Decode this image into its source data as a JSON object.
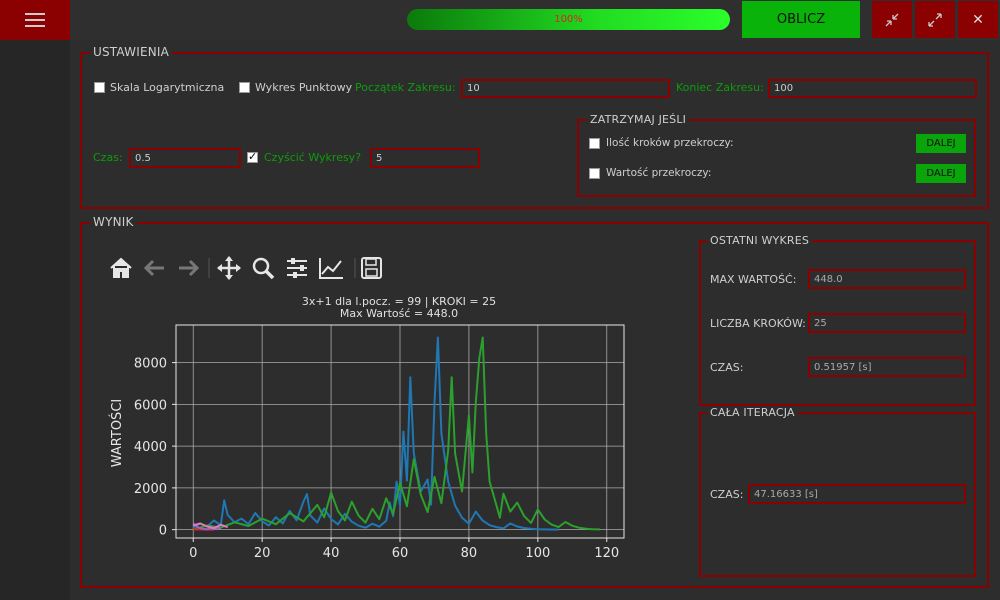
{
  "header": {
    "progress_value": 1.0,
    "progress_text": "100%",
    "calc_label": "OBLICZ",
    "menu_icon": "hamburger-icon",
    "win_icons": [
      "minimize-icon",
      "maximize-icon",
      "close-icon"
    ]
  },
  "settings": {
    "title": "USTAWIENIA",
    "log_scale_label": "Skala Logarytmiczna",
    "log_scale_checked": false,
    "point_plot_label": "Wykres Punktowy",
    "point_plot_checked": false,
    "range_start_label": "Początek Zakresu:",
    "range_start_value": "10",
    "range_end_label": "Koniec Zakresu:",
    "range_end_value": "100",
    "time_label": "Czas:",
    "time_value": "0.5",
    "clear_label": "Czyścić Wykresy?",
    "clear_checked": true,
    "clear_value": "5",
    "stop": {
      "title": "ZATRZYMAJ JEŚLI",
      "steps_label": "Ilość kroków przekroczy:",
      "steps_checked": false,
      "steps_button": "DALEJ",
      "value_label": "Wartość przekroczy:",
      "value_checked": false,
      "value_button": "DALEJ"
    }
  },
  "result": {
    "title": "WYNIK",
    "toolbar": [
      "home-icon",
      "back-arrow-icon",
      "forward-arrow-icon",
      "pan-icon",
      "zoom-icon",
      "configure-icon",
      "edit-curve-icon",
      "save-icon"
    ],
    "last_plot": {
      "title": "OSTATNI WYKRES",
      "max_label": "MAX WARTOŚĆ:",
      "max_value": "448.0",
      "steps_label": "LICZBA KROKÓW:",
      "steps_value": "25",
      "time_label": "CZAS:",
      "time_value": "0.51957 [s]"
    },
    "whole_iteration": {
      "title": "CAŁA ITERACJA",
      "time_label": "CZAS:",
      "time_value": "47.16633 [s]"
    }
  },
  "colors": {
    "accent_red": "#8b0000",
    "accent_green": "#09b309",
    "label_green": "#0b9d0b"
  },
  "chart_data": {
    "type": "line",
    "title": "3x+1 dla l.pocz. = 99 | KROKI = 25",
    "subtitle": "Max Wartość = 448.0",
    "xlabel": "",
    "ylabel": "WARTOŚCI",
    "xlim": [
      -5,
      125
    ],
    "ylim": [
      -400,
      9800
    ],
    "xticks": [
      0,
      20,
      40,
      60,
      80,
      100,
      120
    ],
    "yticks": [
      0,
      2000,
      4000,
      6000,
      8000
    ],
    "grid": true,
    "series": [
      {
        "color": "#1f77b4",
        "points": [
          [
            0,
            97
          ],
          [
            2,
            292
          ],
          [
            4,
            146
          ],
          [
            6,
            440
          ],
          [
            8,
            220
          ],
          [
            9,
            1400
          ],
          [
            10,
            700
          ],
          [
            12,
            350
          ],
          [
            14,
            530
          ],
          [
            16,
            265
          ],
          [
            18,
            796
          ],
          [
            20,
            398
          ],
          [
            22,
            199
          ],
          [
            24,
            598
          ],
          [
            26,
            299
          ],
          [
            28,
            898
          ],
          [
            30,
            449
          ],
          [
            32,
            1348
          ],
          [
            33,
            1700
          ],
          [
            34,
            674
          ],
          [
            36,
            337
          ],
          [
            38,
            1012
          ],
          [
            40,
            506
          ],
          [
            42,
            253
          ],
          [
            44,
            760
          ],
          [
            46,
            380
          ],
          [
            48,
            190
          ],
          [
            50,
            95
          ],
          [
            52,
            286
          ],
          [
            54,
            143
          ],
          [
            56,
            430
          ],
          [
            57,
            1300
          ],
          [
            58,
            650
          ],
          [
            59,
            2300
          ],
          [
            60,
            1150
          ],
          [
            61,
            4700
          ],
          [
            62,
            2350
          ],
          [
            63,
            7300
          ],
          [
            64,
            3650
          ],
          [
            66,
            1825
          ],
          [
            68,
            2400
          ],
          [
            69,
            1200
          ],
          [
            70,
            6100
          ],
          [
            71,
            9200
          ],
          [
            72,
            4600
          ],
          [
            74,
            2300
          ],
          [
            76,
            1150
          ],
          [
            78,
            575
          ],
          [
            80,
            287
          ],
          [
            82,
            862
          ],
          [
            84,
            431
          ],
          [
            86,
            215
          ],
          [
            88,
            120
          ],
          [
            90,
            60
          ],
          [
            92,
            300
          ],
          [
            94,
            150
          ],
          [
            96,
            80
          ],
          [
            98,
            40
          ],
          [
            100,
            20
          ],
          [
            102,
            10
          ],
          [
            104,
            5
          ],
          [
            106,
            2
          ]
        ]
      },
      {
        "color": "#2ca02c",
        "points": [
          [
            0,
            0
          ],
          [
            4,
            200
          ],
          [
            8,
            100
          ],
          [
            12,
            350
          ],
          [
            16,
            175
          ],
          [
            20,
            526
          ],
          [
            24,
            263
          ],
          [
            28,
            790
          ],
          [
            32,
            395
          ],
          [
            36,
            1186
          ],
          [
            38,
            593
          ],
          [
            40,
            1780
          ],
          [
            42,
            890
          ],
          [
            44,
            445
          ],
          [
            46,
            1336
          ],
          [
            48,
            668
          ],
          [
            50,
            334
          ],
          [
            52,
            1000
          ],
          [
            54,
            500
          ],
          [
            56,
            1500
          ],
          [
            58,
            750
          ],
          [
            60,
            2250
          ],
          [
            62,
            1125
          ],
          [
            64,
            3376
          ],
          [
            66,
            1688
          ],
          [
            68,
            844
          ],
          [
            70,
            2532
          ],
          [
            72,
            1266
          ],
          [
            74,
            3800
          ],
          [
            75,
            7300
          ],
          [
            76,
            3650
          ],
          [
            78,
            1825
          ],
          [
            80,
            5476
          ],
          [
            81,
            2738
          ],
          [
            82,
            6100
          ],
          [
            83,
            8200
          ],
          [
            84,
            9200
          ],
          [
            85,
            4600
          ],
          [
            86,
            2300
          ],
          [
            88,
            1150
          ],
          [
            89,
            575
          ],
          [
            90,
            1726
          ],
          [
            92,
            863
          ],
          [
            94,
            1294
          ],
          [
            96,
            647
          ],
          [
            98,
            323
          ],
          [
            100,
            970
          ],
          [
            102,
            485
          ],
          [
            104,
            242
          ],
          [
            106,
            121
          ],
          [
            108,
            364
          ],
          [
            110,
            182
          ],
          [
            112,
            91
          ],
          [
            114,
            45
          ],
          [
            116,
            22
          ],
          [
            118,
            10
          ]
        ]
      },
      {
        "color": "#d62728",
        "points": [
          [
            0,
            10
          ],
          [
            1,
            5
          ],
          [
            2,
            16
          ],
          [
            3,
            8
          ],
          [
            4,
            4
          ],
          [
            5,
            2
          ],
          [
            6,
            1
          ]
        ]
      },
      {
        "color": "#9467bd",
        "points": [
          [
            0,
            300
          ],
          [
            1,
            150
          ],
          [
            2,
            76
          ],
          [
            3,
            38
          ],
          [
            4,
            19
          ],
          [
            5,
            58
          ],
          [
            6,
            29
          ],
          [
            7,
            88
          ],
          [
            8,
            44
          ]
        ]
      },
      {
        "color": "#e377c2",
        "points": [
          [
            0,
            200
          ],
          [
            2,
            300
          ],
          [
            4,
            150
          ],
          [
            6,
            75
          ],
          [
            8,
            230
          ],
          [
            10,
            115
          ]
        ]
      }
    ]
  }
}
